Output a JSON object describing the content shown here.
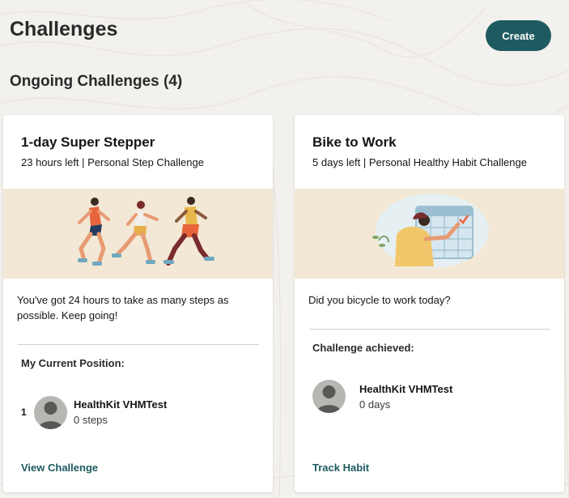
{
  "page": {
    "title": "Challenges"
  },
  "header": {
    "create_label": "Create"
  },
  "section": {
    "title": "Ongoing Challenges (4)"
  },
  "colors": {
    "accent": "#1e5b61",
    "banner_bg": "#f2e8d5",
    "page_bg": "#f3f1ed"
  },
  "cards": [
    {
      "title": "1-day Super Stepper",
      "subtitle": "23 hours left | Personal Step Challenge",
      "image_icon": "runners-illustration",
      "description": "You've got 24 hours to take as many steps as possible. Keep going!",
      "section_label": "My Current Position:",
      "rank": "1",
      "participant_name": "HealthKit VHMTest",
      "participant_value": "0 steps",
      "action_label": "View Challenge"
    },
    {
      "title": "Bike to Work",
      "subtitle": "5 days left | Personal Healthy Habit Challenge",
      "image_icon": "calendar-checkmark-illustration",
      "description": "Did you bicycle to work today?",
      "section_label": "Challenge achieved:",
      "participant_name": "HealthKit VHMTest",
      "participant_value": "0 days",
      "action_label": "Track Habit"
    }
  ]
}
